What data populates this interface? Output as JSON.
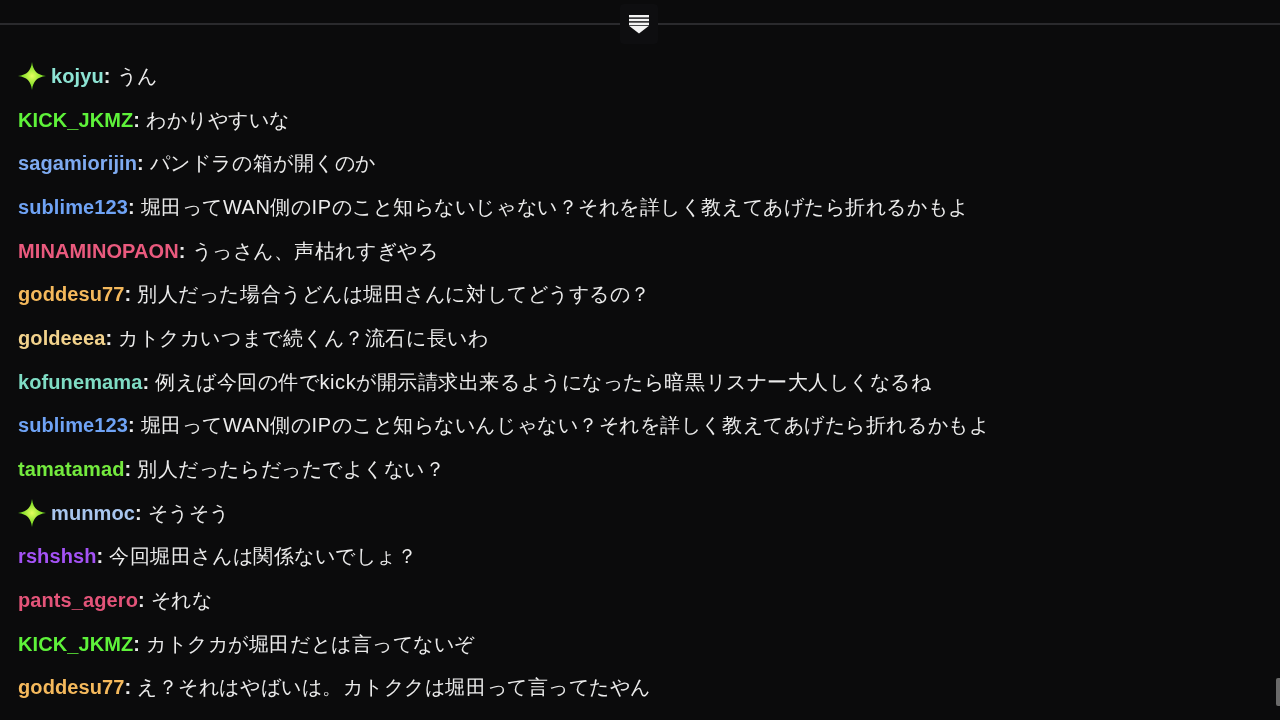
{
  "chat": {
    "name_separator": ":",
    "messages": [
      {
        "user": "kojyu",
        "color": "#8de4d4",
        "badge": true,
        "text": "うん"
      },
      {
        "user": "KICK_JKMZ",
        "color": "#5ef23a",
        "badge": false,
        "text": "わかりやすいな"
      },
      {
        "user": "sagamiorijin",
        "color": "#7eaaf0",
        "badge": false,
        "text": "パンドラの箱が開くのか"
      },
      {
        "user": "sublime123",
        "color": "#6fa3f5",
        "badge": false,
        "text": "堀田ってWAN側のIPのこと知らないじゃない？それを詳しく教えてあげたら折れるかもよ"
      },
      {
        "user": "MINAMINOPAON",
        "color": "#ea5a7e",
        "badge": false,
        "text": "うっさん、声枯れすぎやろ"
      },
      {
        "user": "goddesu77",
        "color": "#f5b95c",
        "badge": false,
        "text": "別人だった場合うどんは堀田さんに対してどうするの？"
      },
      {
        "user": "goldeeea",
        "color": "#f2d28c",
        "badge": false,
        "text": "カトクカいつまで続くん？流石に長いわ"
      },
      {
        "user": "kofunemama",
        "color": "#7fdcc4",
        "badge": false,
        "text": "例えば今回の件でkickが開示請求出来るようになったら暗黒リスナー大人しくなるね"
      },
      {
        "user": "sublime123",
        "color": "#6fa3f5",
        "badge": false,
        "text": "堀田ってWAN側のIPのこと知らないんじゃない？それを詳しく教えてあげたら折れるかもよ"
      },
      {
        "user": "tamatamad",
        "color": "#74ea3e",
        "badge": false,
        "text": "別人だったらだったでよくない？"
      },
      {
        "user": "munmoc",
        "color": "#a9c6ee",
        "badge": true,
        "text": "そうそう"
      },
      {
        "user": "rshshsh",
        "color": "#a452f5",
        "badge": false,
        "text": "今回堀田さんは関係ないでしょ？"
      },
      {
        "user": "pants_agero",
        "color": "#e35479",
        "badge": false,
        "text": "それな"
      },
      {
        "user": "KICK_JKMZ",
        "color": "#5ef23a",
        "badge": false,
        "text": "カトクカが堀田だとは言ってないぞ"
      },
      {
        "user": "goddesu77",
        "color": "#f5b95c",
        "badge": false,
        "text": "え？それはやばいは。カトククは堀田って言ってたやん"
      }
    ]
  }
}
